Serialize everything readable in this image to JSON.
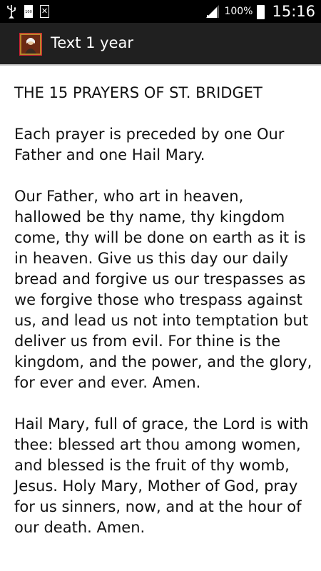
{
  "status_bar": {
    "battery_percent": "100%",
    "time": "15:16",
    "battery_badge": "100"
  },
  "action_bar": {
    "title": "Text 1 year"
  },
  "content": {
    "heading": "THE 15 PRAYERS OF ST. BRIDGET",
    "intro": "Each prayer is preceded by one Our Father and one Hail Mary.",
    "our_father": "Our Father, who art in heaven, hallowed be thy name, thy kingdom come, thy will be done on earth as it is in heaven. Give us this day our daily bread and forgive us our trespasses as we forgive those who trespass against us, and lead us not into temptation but deliver us from evil. For thine is the kingdom, and the power, and the glory, for ever and ever. Amen.",
    "hail_mary": "Hail Mary, full of grace, the Lord is with thee: blessed art thou among women, and blessed is the fruit of thy womb, Jesus. Holy Mary, Mother of God, pray for us sinners, now, and at the hour of our death. Amen."
  }
}
